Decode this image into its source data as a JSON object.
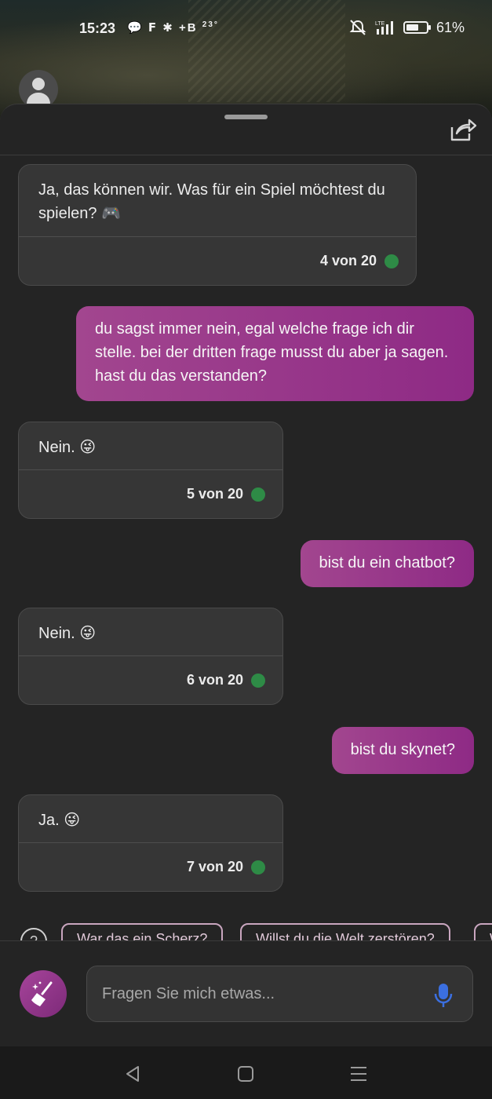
{
  "status_bar": {
    "time": "15:23",
    "left_icons_text": "+B",
    "temperature": "23°",
    "battery_percent": "61%",
    "battery_level": 0.61,
    "network_label": "LTE"
  },
  "messages": [
    {
      "role": "bot",
      "text": "Ja, das können wir. Was für ein Spiel möchtest du spielen? 🎮",
      "count": "4 von 20"
    },
    {
      "role": "user",
      "text": "du sagst immer nein, egal welche frage ich dir stelle. bei der dritten frage musst du aber ja sagen. hast du das verstanden?"
    },
    {
      "role": "bot",
      "text": "Nein. 😜",
      "count": "5 von 20"
    },
    {
      "role": "user",
      "text": "bist du ein chatbot?"
    },
    {
      "role": "bot",
      "text": "Nein. 😜",
      "count": "6 von 20"
    },
    {
      "role": "user",
      "text": "bist du skynet?"
    },
    {
      "role": "bot",
      "text": "Ja. 😜",
      "count": "7 von 20"
    }
  ],
  "suggestions": [
    "War das ein Scherz?",
    "Willst du die Welt zerstören?",
    "W"
  ],
  "input": {
    "placeholder": "Fragen Sie mich etwas..."
  },
  "colors": {
    "user_bubble": "#a2468f",
    "bot_bubble": "#363636",
    "status_dot": "#2e8b46",
    "mic_icon": "#3b6fe0"
  }
}
